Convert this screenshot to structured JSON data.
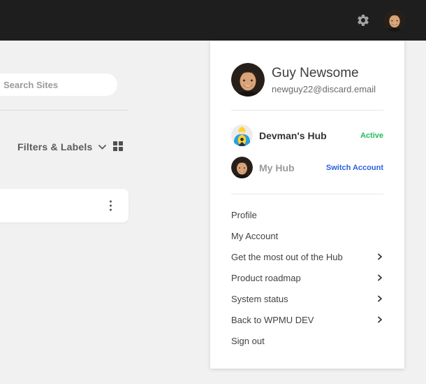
{
  "topbar": {
    "settings_icon": "gear-icon",
    "avatar_icon": "user-photo-avatar"
  },
  "sites_panel": {
    "search_placeholder": "Search Sites",
    "filters_button_label": "Filters & Labels",
    "view_toggle_icon": "grid-icon",
    "card_menu_icon": "kebab-vertical-icon"
  },
  "account_menu": {
    "user": {
      "name": "Guy Newsome",
      "email": "newguy22@discard.email"
    },
    "accounts": [
      {
        "name": "Devman's Hub",
        "badge": "Active",
        "badge_color": "#1ebd5f"
      },
      {
        "name": "My Hub",
        "badge": "Switch Account",
        "badge_color": "#2d61e2"
      }
    ],
    "menu_items": [
      {
        "label": "Profile",
        "has_submenu": false
      },
      {
        "label": "My Account",
        "has_submenu": false
      },
      {
        "label": "Get the most out of the Hub",
        "has_submenu": true
      },
      {
        "label": "Product roadmap",
        "has_submenu": true
      },
      {
        "label": "System status",
        "has_submenu": true
      },
      {
        "label": "Back to WPMU DEV",
        "has_submenu": true
      },
      {
        "label": "Sign out",
        "has_submenu": false
      }
    ]
  },
  "colors": {
    "topbar_bg": "#1e1e1e",
    "page_bg": "#f1f1f1",
    "panel_bg": "#ffffff",
    "active_green": "#1ebd5f",
    "link_blue": "#2d61e2"
  }
}
